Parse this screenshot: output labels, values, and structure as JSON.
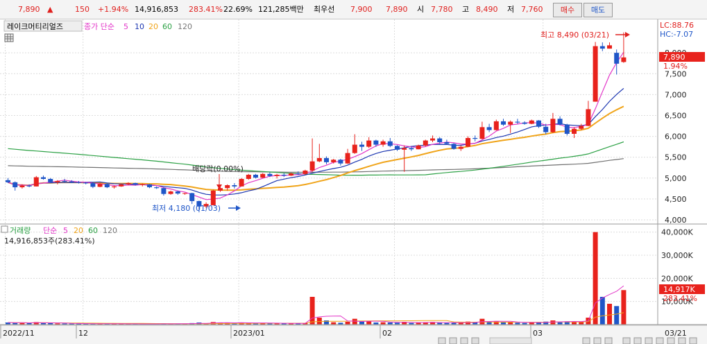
{
  "header": {
    "price": "7,890",
    "change_arrow": "▲",
    "change": "150",
    "change_pct": "+1.94%",
    "volume": "14,916,853",
    "volume_ratio": "283.41%",
    "turnover": "22.69%",
    "trade_value": "121,285백만",
    "best_label": "최우선",
    "best_ask": "7,900",
    "best_bid": "7,890",
    "open_label": "시",
    "open": "7,780",
    "high_label": "고",
    "high": "8,490",
    "low_label": "저",
    "low": "7,760",
    "buy_label": "매수",
    "sell_label": "매도"
  },
  "legend": {
    "stock_name": "레이크머티리얼즈",
    "ma_label": "종가 단순",
    "ma_periods": [
      "5",
      "10",
      "20",
      "60",
      "120"
    ],
    "lc": "LC:88.76",
    "hc": "HC:-7.07"
  },
  "annotations": {
    "high_text": "최고 8,490 (03/21)",
    "low_text": "최저 4,180 (01/03)",
    "ex_div": "배당락(0.00%)",
    "price_tag": "7,890",
    "price_pct_tag": "1.94%",
    "vol_tag": "14,917K",
    "vol_pct_tag": "283.41%"
  },
  "volume_panel": {
    "title": "거래량",
    "ma_label": "단순",
    "ma_periods": [
      "5",
      "20",
      "60",
      "120"
    ],
    "current": "14,916,853주(283.41%)"
  },
  "price_axis": [
    "8,000",
    "7,500",
    "7,000",
    "6,500",
    "6,000",
    "5,500",
    "5,000",
    "4,500",
    "4,000"
  ],
  "volume_axis": [
    "40,000K",
    "30,000K",
    "20,000K",
    "10,000K"
  ],
  "date_axis": [
    "2022/11",
    "12",
    "2023/01",
    "02",
    "03",
    "03/21"
  ],
  "colors": {
    "up": "#e8221c",
    "down": "#1f56c8",
    "ma5": "#e236c8",
    "ma10": "#1b35b0",
    "ma20": "#f0a419",
    "ma60": "#2aa043",
    "ma120": "#707070"
  },
  "chart_data": {
    "type": "candlestick",
    "ylim": [
      3900,
      8800
    ],
    "vol_ylim": [
      0,
      42000
    ],
    "candles": [
      {
        "o": 4950,
        "h": 5000,
        "l": 4880,
        "c": 4900,
        "v": 900
      },
      {
        "o": 4900,
        "h": 4920,
        "l": 4700,
        "c": 4780,
        "v": 800
      },
      {
        "o": 4780,
        "h": 4850,
        "l": 4750,
        "c": 4820,
        "v": 700
      },
      {
        "o": 4820,
        "h": 4850,
        "l": 4780,
        "c": 4800,
        "v": 600
      },
      {
        "o": 4800,
        "h": 5050,
        "l": 4800,
        "c": 5020,
        "v": 1100
      },
      {
        "o": 5020,
        "h": 5060,
        "l": 4960,
        "c": 4980,
        "v": 700
      },
      {
        "o": 4980,
        "h": 5000,
        "l": 4880,
        "c": 4900,
        "v": 700
      },
      {
        "o": 4900,
        "h": 4950,
        "l": 4850,
        "c": 4930,
        "v": 500
      },
      {
        "o": 4930,
        "h": 4980,
        "l": 4900,
        "c": 4920,
        "v": 450
      },
      {
        "o": 4920,
        "h": 4950,
        "l": 4880,
        "c": 4900,
        "v": 400
      },
      {
        "o": 4900,
        "h": 4930,
        "l": 4870,
        "c": 4890,
        "v": 380
      },
      {
        "o": 4890,
        "h": 4910,
        "l": 4850,
        "c": 4880,
        "v": 360
      },
      {
        "o": 4880,
        "h": 4900,
        "l": 4760,
        "c": 4790,
        "v": 420
      },
      {
        "o": 4790,
        "h": 4880,
        "l": 4780,
        "c": 4860,
        "v": 350
      },
      {
        "o": 4860,
        "h": 4880,
        "l": 4760,
        "c": 4780,
        "v": 330
      },
      {
        "o": 4780,
        "h": 4820,
        "l": 4750,
        "c": 4800,
        "v": 300
      },
      {
        "o": 4800,
        "h": 4860,
        "l": 4790,
        "c": 4850,
        "v": 350
      },
      {
        "o": 4850,
        "h": 4900,
        "l": 4830,
        "c": 4880,
        "v": 340
      },
      {
        "o": 4880,
        "h": 4890,
        "l": 4820,
        "c": 4840,
        "v": 300
      },
      {
        "o": 4840,
        "h": 4870,
        "l": 4800,
        "c": 4850,
        "v": 280
      },
      {
        "o": 4850,
        "h": 4860,
        "l": 4760,
        "c": 4780,
        "v": 300
      },
      {
        "o": 4780,
        "h": 4800,
        "l": 4740,
        "c": 4760,
        "v": 280
      },
      {
        "o": 4760,
        "h": 4780,
        "l": 4580,
        "c": 4620,
        "v": 420
      },
      {
        "o": 4620,
        "h": 4700,
        "l": 4600,
        "c": 4680,
        "v": 400
      },
      {
        "o": 4680,
        "h": 4700,
        "l": 4600,
        "c": 4630,
        "v": 350
      },
      {
        "o": 4630,
        "h": 4650,
        "l": 4600,
        "c": 4640,
        "v": 300
      },
      {
        "o": 4640,
        "h": 4650,
        "l": 4380,
        "c": 4450,
        "v": 650
      },
      {
        "o": 4450,
        "h": 4460,
        "l": 4180,
        "c": 4320,
        "v": 900
      },
      {
        "o": 4320,
        "h": 4420,
        "l": 4280,
        "c": 4380,
        "v": 500
      },
      {
        "o": 4350,
        "h": 4720,
        "l": 4350,
        "c": 4700,
        "v": 1100
      },
      {
        "o": 4700,
        "h": 4780,
        "l": 4670,
        "c": 4760,
        "v": 800
      },
      {
        "o": 4760,
        "h": 4850,
        "l": 4700,
        "c": 4830,
        "v": 700
      },
      {
        "o": 4830,
        "h": 4880,
        "l": 4750,
        "c": 4800,
        "v": 600
      },
      {
        "o": 4800,
        "h": 5000,
        "l": 4800,
        "c": 4980,
        "v": 800
      },
      {
        "o": 4980,
        "h": 5100,
        "l": 4960,
        "c": 5080,
        "v": 900
      },
      {
        "o": 5080,
        "h": 5100,
        "l": 4990,
        "c": 5010,
        "v": 600
      },
      {
        "o": 5010,
        "h": 5120,
        "l": 5000,
        "c": 5100,
        "v": 650
      },
      {
        "o": 5100,
        "h": 5140,
        "l": 5030,
        "c": 5050,
        "v": 550
      },
      {
        "o": 5050,
        "h": 5100,
        "l": 4990,
        "c": 5080,
        "v": 500
      },
      {
        "o": 5080,
        "h": 5120,
        "l": 5030,
        "c": 5060,
        "v": 480
      },
      {
        "o": 5060,
        "h": 5130,
        "l": 5050,
        "c": 5110,
        "v": 520
      },
      {
        "o": 5110,
        "h": 5160,
        "l": 5070,
        "c": 5100,
        "v": 500
      },
      {
        "o": 5100,
        "h": 5200,
        "l": 5080,
        "c": 5180,
        "v": 650
      },
      {
        "o": 5180,
        "h": 5950,
        "l": 5150,
        "c": 5400,
        "v": 12000
      },
      {
        "o": 5400,
        "h": 5820,
        "l": 5380,
        "c": 5480,
        "v": 3000
      },
      {
        "o": 5480,
        "h": 5520,
        "l": 5330,
        "c": 5380,
        "v": 1800
      },
      {
        "o": 5380,
        "h": 5460,
        "l": 5350,
        "c": 5440,
        "v": 1000
      },
      {
        "o": 5440,
        "h": 5460,
        "l": 5300,
        "c": 5350,
        "v": 800
      },
      {
        "o": 5350,
        "h": 5700,
        "l": 5340,
        "c": 5600,
        "v": 1200
      },
      {
        "o": 5600,
        "h": 6050,
        "l": 5580,
        "c": 5800,
        "v": 2500
      },
      {
        "o": 5800,
        "h": 5870,
        "l": 5650,
        "c": 5750,
        "v": 1300
      },
      {
        "o": 5750,
        "h": 5980,
        "l": 5720,
        "c": 5900,
        "v": 1500
      },
      {
        "o": 5900,
        "h": 5920,
        "l": 5750,
        "c": 5800,
        "v": 900
      },
      {
        "o": 5800,
        "h": 5920,
        "l": 5750,
        "c": 5880,
        "v": 1000
      },
      {
        "o": 5880,
        "h": 5960,
        "l": 5740,
        "c": 5770,
        "v": 900
      },
      {
        "o": 5770,
        "h": 5790,
        "l": 5650,
        "c": 5680,
        "v": 800
      },
      {
        "o": 5680,
        "h": 5780,
        "l": 5150,
        "c": 5720,
        "v": 1200
      },
      {
        "o": 5720,
        "h": 5760,
        "l": 5650,
        "c": 5690,
        "v": 700
      },
      {
        "o": 5690,
        "h": 5800,
        "l": 5690,
        "c": 5780,
        "v": 750
      },
      {
        "o": 5780,
        "h": 5920,
        "l": 5760,
        "c": 5900,
        "v": 1000
      },
      {
        "o": 5900,
        "h": 6020,
        "l": 5860,
        "c": 5950,
        "v": 1100
      },
      {
        "o": 5950,
        "h": 5980,
        "l": 5820,
        "c": 5860,
        "v": 800
      },
      {
        "o": 5860,
        "h": 5920,
        "l": 5800,
        "c": 5820,
        "v": 700
      },
      {
        "o": 5820,
        "h": 5840,
        "l": 5680,
        "c": 5700,
        "v": 750
      },
      {
        "o": 5700,
        "h": 5780,
        "l": 5650,
        "c": 5750,
        "v": 800
      },
      {
        "o": 5750,
        "h": 6000,
        "l": 5740,
        "c": 5960,
        "v": 1300
      },
      {
        "o": 5960,
        "h": 6020,
        "l": 5880,
        "c": 5940,
        "v": 900
      },
      {
        "o": 5940,
        "h": 6350,
        "l": 5930,
        "c": 6220,
        "v": 2500
      },
      {
        "o": 6220,
        "h": 6300,
        "l": 6100,
        "c": 6150,
        "v": 1200
      },
      {
        "o": 6150,
        "h": 6400,
        "l": 6140,
        "c": 6360,
        "v": 1400
      },
      {
        "o": 6360,
        "h": 6420,
        "l": 6250,
        "c": 6280,
        "v": 1000
      },
      {
        "o": 6280,
        "h": 6380,
        "l": 6080,
        "c": 6350,
        "v": 1100
      },
      {
        "o": 6350,
        "h": 6420,
        "l": 6300,
        "c": 6330,
        "v": 800
      },
      {
        "o": 6330,
        "h": 6360,
        "l": 6280,
        "c": 6300,
        "v": 700
      },
      {
        "o": 6300,
        "h": 6400,
        "l": 6290,
        "c": 6380,
        "v": 900
      },
      {
        "o": 6380,
        "h": 6390,
        "l": 6200,
        "c": 6230,
        "v": 1000
      },
      {
        "o": 6230,
        "h": 6300,
        "l": 6050,
        "c": 6100,
        "v": 1300
      },
      {
        "o": 6100,
        "h": 6560,
        "l": 6080,
        "c": 6420,
        "v": 1800
      },
      {
        "o": 6420,
        "h": 6480,
        "l": 6260,
        "c": 6280,
        "v": 1000
      },
      {
        "o": 6280,
        "h": 6300,
        "l": 6020,
        "c": 6060,
        "v": 1400
      },
      {
        "o": 6060,
        "h": 6220,
        "l": 5960,
        "c": 6180,
        "v": 1300
      },
      {
        "o": 6180,
        "h": 6300,
        "l": 6150,
        "c": 6250,
        "v": 1100
      },
      {
        "o": 6250,
        "h": 6850,
        "l": 6240,
        "c": 6650,
        "v": 3000
      },
      {
        "o": 6830,
        "h": 8260,
        "l": 6830,
        "c": 8160,
        "v": 40000
      },
      {
        "o": 8160,
        "h": 8250,
        "l": 8040,
        "c": 8100,
        "v": 12000
      },
      {
        "o": 8100,
        "h": 8250,
        "l": 8100,
        "c": 8180,
        "v": 9000
      },
      {
        "o": 8000,
        "h": 8080,
        "l": 7480,
        "c": 7740,
        "v": 8000
      },
      {
        "o": 7780,
        "h": 8490,
        "l": 7760,
        "c": 7890,
        "v": 14917
      }
    ]
  }
}
